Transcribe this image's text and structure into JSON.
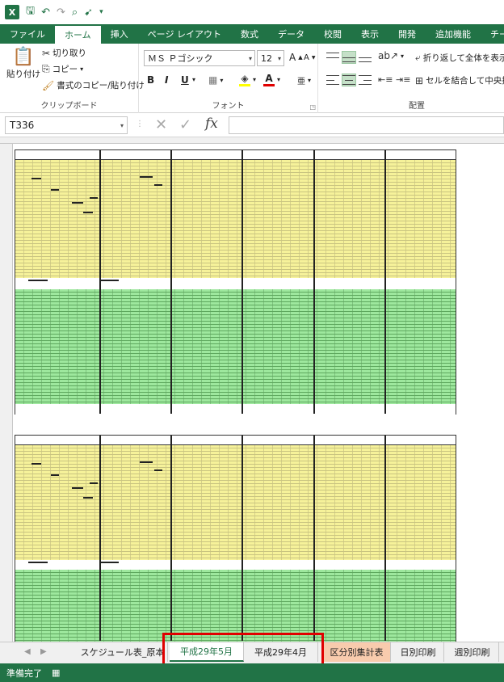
{
  "qat": {
    "excel_logo": "X",
    "icons": [
      "save-icon",
      "undo-icon",
      "redo-icon",
      "print-preview-icon",
      "pointer-icon",
      "customize-icon"
    ]
  },
  "ribbon_tabs": [
    "ファイル",
    "ホーム",
    "挿入",
    "ページ レイアウト",
    "数式",
    "データ",
    "校閲",
    "表示",
    "開発",
    "追加機能",
    "チーム"
  ],
  "clipboard": {
    "paste": "貼り付け",
    "cut": "切り取り",
    "copy": "コピー",
    "format_painter": "書式のコピー/貼り付け",
    "label": "クリップボード"
  },
  "font": {
    "name": "ＭＳ Ｐゴシック",
    "size": "12",
    "grow": "A",
    "shrink": "A",
    "bold": "B",
    "italic": "I",
    "underline": "U",
    "font_color": "A",
    "label": "フォント"
  },
  "alignment": {
    "wrap": "折り返して全体を表示",
    "merge": "セルを結合して中央揃",
    "label": "配置"
  },
  "formula_bar": {
    "name_box": "T336",
    "cancel": "✕",
    "enter": "✓",
    "fx": "fx",
    "formula": ""
  },
  "sheet_tabs": [
    {
      "label": "スケジュール表_原本",
      "active": false
    },
    {
      "label": "平成29年5月",
      "active": true
    },
    {
      "label": "平成29年4月",
      "active": false
    },
    {
      "label": "区分別集計表",
      "active": false
    },
    {
      "label": "日別印刷",
      "active": false
    },
    {
      "label": "週別印刷",
      "active": false
    }
  ],
  "status": {
    "text": "準備完了"
  },
  "colors": {
    "accent": "#217346",
    "yellow_fill": "#f6f29a",
    "green_fill": "#9ee89e",
    "highlight": "#e00000",
    "tab_orange": "#f8cbad"
  }
}
